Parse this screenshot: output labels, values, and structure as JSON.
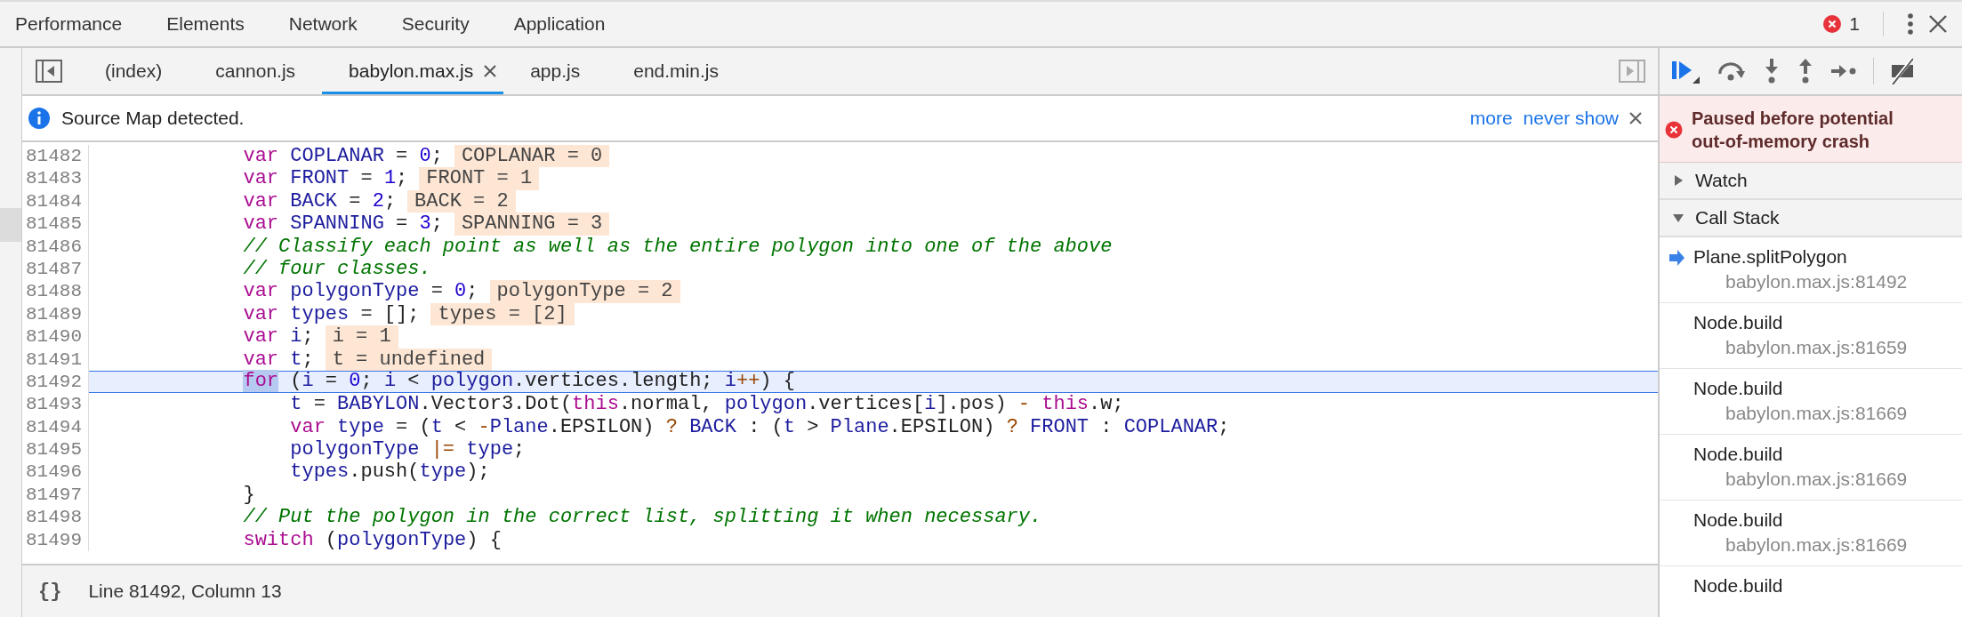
{
  "main_tabs": [
    {
      "label": "Performance"
    },
    {
      "label": "Elements"
    },
    {
      "label": "Network"
    },
    {
      "label": "Security"
    },
    {
      "label": "Application"
    }
  ],
  "error_count": "1",
  "file_tabs": [
    {
      "label": "(index)",
      "selected": false
    },
    {
      "label": "cannon.js",
      "selected": false
    },
    {
      "label": "babylon.max.js",
      "selected": true
    },
    {
      "label": "app.js",
      "selected": false
    },
    {
      "label": "end.min.js",
      "selected": false
    }
  ],
  "info_bar": {
    "message": "Source Map detected.",
    "links": [
      "more",
      "never show"
    ]
  },
  "editor": {
    "lines": [
      {
        "number": "81482",
        "selected": false,
        "inline_value": "COPLANAR = 0",
        "tokens": [
          {
            "kind": "kw",
            "text": "            var "
          },
          {
            "kind": "def",
            "text": "COPLANAR"
          },
          {
            "kind": "plain",
            "text": " = "
          },
          {
            "kind": "num",
            "text": "0"
          },
          {
            "kind": "plain",
            "text": ";"
          }
        ]
      },
      {
        "number": "81483",
        "selected": false,
        "inline_value": "FRONT = 1",
        "tokens": [
          {
            "kind": "kw",
            "text": "            var "
          },
          {
            "kind": "def",
            "text": "FRONT"
          },
          {
            "kind": "plain",
            "text": " = "
          },
          {
            "kind": "num",
            "text": "1"
          },
          {
            "kind": "plain",
            "text": ";"
          }
        ]
      },
      {
        "number": "81484",
        "selected": false,
        "inline_value": "BACK = 2",
        "tokens": [
          {
            "kind": "kw",
            "text": "            var "
          },
          {
            "kind": "def",
            "text": "BACK"
          },
          {
            "kind": "plain",
            "text": " = "
          },
          {
            "kind": "num",
            "text": "2"
          },
          {
            "kind": "plain",
            "text": ";"
          }
        ]
      },
      {
        "number": "81485",
        "selected": false,
        "inline_value": "SPANNING = 3",
        "tokens": [
          {
            "kind": "kw",
            "text": "            var "
          },
          {
            "kind": "def",
            "text": "SPANNING"
          },
          {
            "kind": "plain",
            "text": " = "
          },
          {
            "kind": "num",
            "text": "3"
          },
          {
            "kind": "plain",
            "text": ";"
          }
        ]
      },
      {
        "number": "81486",
        "selected": false,
        "tokens": [
          {
            "kind": "com",
            "text": "            // Classify each point as well as the entire polygon into one of the above"
          }
        ]
      },
      {
        "number": "81487",
        "selected": false,
        "tokens": [
          {
            "kind": "com",
            "text": "            // four classes."
          }
        ]
      },
      {
        "number": "81488",
        "selected": false,
        "inline_value": "polygonType = 2",
        "tokens": [
          {
            "kind": "kw",
            "text": "            var "
          },
          {
            "kind": "def",
            "text": "polygonType"
          },
          {
            "kind": "plain",
            "text": " = "
          },
          {
            "kind": "num",
            "text": "0"
          },
          {
            "kind": "plain",
            "text": ";"
          }
        ]
      },
      {
        "number": "81489",
        "selected": false,
        "inline_value": "types = [2]",
        "tokens": [
          {
            "kind": "kw",
            "text": "            var "
          },
          {
            "kind": "def",
            "text": "types"
          },
          {
            "kind": "plain",
            "text": " = [];"
          }
        ]
      },
      {
        "number": "81490",
        "selected": false,
        "inline_value": "i = 1",
        "tokens": [
          {
            "kind": "kw",
            "text": "            var "
          },
          {
            "kind": "def",
            "text": "i"
          },
          {
            "kind": "plain",
            "text": ";"
          }
        ]
      },
      {
        "number": "81491",
        "selected": false,
        "inline_value": "t = undefined",
        "tokens": [
          {
            "kind": "kw",
            "text": "            var "
          },
          {
            "kind": "def",
            "text": "t"
          },
          {
            "kind": "plain",
            "text": ";"
          }
        ]
      },
      {
        "number": "81492",
        "selected": true,
        "tokens": [
          {
            "kind": "hit",
            "text": "            for"
          },
          {
            "kind": "plain",
            "text": " ("
          },
          {
            "kind": "def",
            "text": "i"
          },
          {
            "kind": "plain",
            "text": " = "
          },
          {
            "kind": "num",
            "text": "0"
          },
          {
            "kind": "plain",
            "text": "; "
          },
          {
            "kind": "def",
            "text": "i"
          },
          {
            "kind": "plain",
            "text": " < "
          },
          {
            "kind": "def",
            "text": "polygon"
          },
          {
            "kind": "plain",
            "text": ".vertices.length; "
          },
          {
            "kind": "def",
            "text": "i"
          },
          {
            "kind": "op",
            "text": "++"
          },
          {
            "kind": "plain",
            "text": ") {"
          }
        ]
      },
      {
        "number": "81493",
        "selected": false,
        "tokens": [
          {
            "kind": "def",
            "text": "                t"
          },
          {
            "kind": "plain",
            "text": " = "
          },
          {
            "kind": "def",
            "text": "BABYLON"
          },
          {
            "kind": "plain",
            "text": ".Vector3.Dot("
          },
          {
            "kind": "kw",
            "text": "this"
          },
          {
            "kind": "plain",
            "text": ".normal, "
          },
          {
            "kind": "def",
            "text": "polygon"
          },
          {
            "kind": "plain",
            "text": ".vertices["
          },
          {
            "kind": "def",
            "text": "i"
          },
          {
            "kind": "plain",
            "text": "].pos) "
          },
          {
            "kind": "op",
            "text": "-"
          },
          {
            "kind": "kw",
            "text": " this"
          },
          {
            "kind": "plain",
            "text": ".w;"
          }
        ]
      },
      {
        "number": "81494",
        "selected": false,
        "tokens": [
          {
            "kind": "kw",
            "text": "                var "
          },
          {
            "kind": "def",
            "text": "type"
          },
          {
            "kind": "plain",
            "text": " = ("
          },
          {
            "kind": "def",
            "text": "t"
          },
          {
            "kind": "plain",
            "text": " < "
          },
          {
            "kind": "op",
            "text": "-"
          },
          {
            "kind": "def",
            "text": "Plane"
          },
          {
            "kind": "plain",
            "text": ".EPSILON) "
          },
          {
            "kind": "op",
            "text": "? "
          },
          {
            "kind": "def",
            "text": "BACK"
          },
          {
            "kind": "plain",
            "text": " : ("
          },
          {
            "kind": "def",
            "text": "t"
          },
          {
            "kind": "plain",
            "text": " > "
          },
          {
            "kind": "def",
            "text": "Plane"
          },
          {
            "kind": "plain",
            "text": ".EPSILON) "
          },
          {
            "kind": "op",
            "text": "? "
          },
          {
            "kind": "def",
            "text": "FRONT"
          },
          {
            "kind": "plain",
            "text": " : "
          },
          {
            "kind": "def",
            "text": "COPLANAR"
          },
          {
            "kind": "plain",
            "text": ";"
          }
        ]
      },
      {
        "number": "81495",
        "selected": false,
        "tokens": [
          {
            "kind": "def",
            "text": "                polygonType"
          },
          {
            "kind": "op",
            "text": " |= "
          },
          {
            "kind": "def",
            "text": "type"
          },
          {
            "kind": "plain",
            "text": ";"
          }
        ]
      },
      {
        "number": "81496",
        "selected": false,
        "tokens": [
          {
            "kind": "def",
            "text": "                types"
          },
          {
            "kind": "plain",
            "text": ".push("
          },
          {
            "kind": "def",
            "text": "type"
          },
          {
            "kind": "plain",
            "text": ");"
          }
        ]
      },
      {
        "number": "81497",
        "selected": false,
        "tokens": [
          {
            "kind": "plain",
            "text": "            }"
          }
        ]
      },
      {
        "number": "81498",
        "selected": false,
        "tokens": [
          {
            "kind": "com",
            "text": "            // Put the polygon in the correct list, splitting it when necessary."
          }
        ]
      },
      {
        "number": "81499",
        "selected": false,
        "tokens": [
          {
            "kind": "kw",
            "text": "            switch"
          },
          {
            "kind": "plain",
            "text": " ("
          },
          {
            "kind": "def",
            "text": "polygonType"
          },
          {
            "kind": "plain",
            "text": ") {"
          }
        ]
      }
    ]
  },
  "status_bar": {
    "pretty_print": "{}",
    "position": "Line 81492, Column 13"
  },
  "debugger": {
    "paused_message": "Paused before potential out-of-memory crash",
    "sections": [
      {
        "label": "Watch",
        "expanded": false
      },
      {
        "label": "Call Stack",
        "expanded": true
      }
    ],
    "call_stack": [
      {
        "function": "Plane.splitPolygon",
        "location": "babylon.max.js:81492",
        "selected": true
      },
      {
        "function": "Node.build",
        "location": "babylon.max.js:81659",
        "selected": false
      },
      {
        "function": "Node.build",
        "location": "babylon.max.js:81669",
        "selected": false
      },
      {
        "function": "Node.build",
        "location": "babylon.max.js:81669",
        "selected": false
      },
      {
        "function": "Node.build",
        "location": "babylon.max.js:81669",
        "selected": false
      },
      {
        "function": "Node.build",
        "selected": false
      }
    ]
  }
}
